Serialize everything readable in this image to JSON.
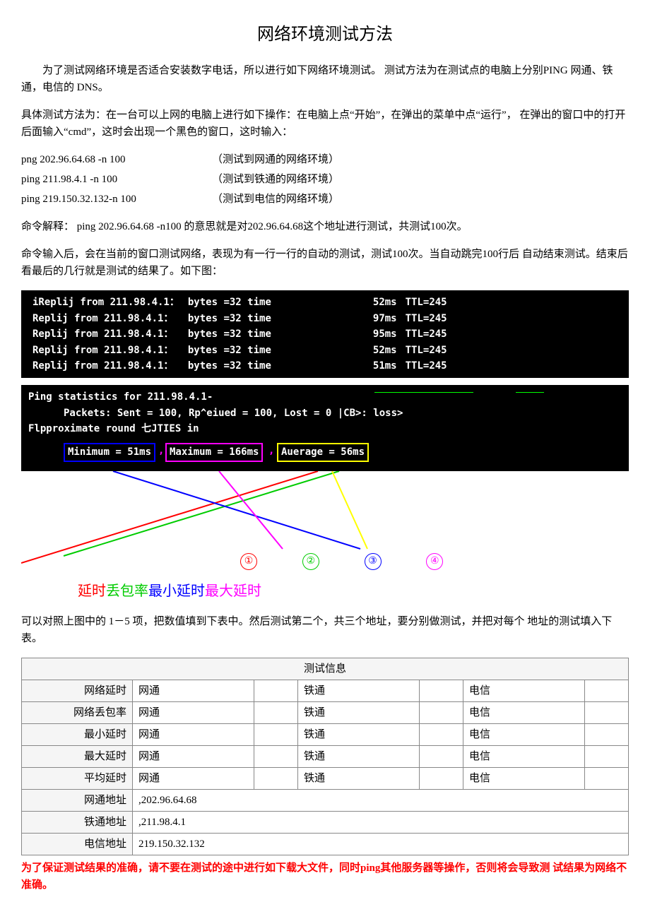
{
  "title": "网络环境测试方法",
  "p1": "为了测试网络环境是否适合安装数字电话，所以进行如下网络环境测试。 测试方法为在测试点的电脑上分别PING 网通、铁通，电信的 DNS。",
  "p2": "具体测试方法为：在一台可以上网的电脑上进行如下操作：在电脑上点“开始”，在弹出的菜单中点“运行”， 在弹出的窗口中的打开后面输入“cmd”，这时会出现一个黑色的窗口，这时输入：",
  "cmds": [
    {
      "cmd": "png 202.96.64.68 -n 100",
      "note": "（测试到网通的网络环境）"
    },
    {
      "cmd": "ping 211.98.4.1 -n 100",
      "note": "（测试到铁通的网络环境）"
    },
    {
      "cmd": "ping 219.150.32.132-n 100",
      "note": "（测试到电信的网络环境）"
    }
  ],
  "explain": "命令解释：  ping 202.96.64.68 -n100 的意思就是对202.96.64.68这个地址进行测试，共测试100次。",
  "p3": "命令输入后，会在当前的窗口测试网络，表现为有一行一行的自动的测试，测试100次。当自动跳完100行后 自动结束测试。结束后看最后的几行就是测试的结果了。如下图：",
  "replies": [
    {
      "a": "iReplij from 211.98.4.1：",
      "b": "bytes =32 time",
      "c": "52ms",
      "d": "TTL=245"
    },
    {
      "a": "Replij from 211.98.4.1：",
      "b": "bytes =32 time",
      "c": "97ms",
      "d": "TTL=245"
    },
    {
      "a": "Replij from 211.98.4.1：",
      "b": "bytes =32 time",
      "c": "95ms",
      "d": "TTL=245"
    },
    {
      "a": "Replij from 211.98.4.1：",
      "b": "bytes =32 time",
      "c": "52ms",
      "d": "TTL=245"
    },
    {
      "a": "Replij from 211.98.4.1：",
      "b": "bytes =32 time",
      "c": "51ms",
      "d": "TTL=245"
    }
  ],
  "stats": {
    "header": "Ping statistics for 211.98.4.1-",
    "packets": "Packets: Sent = 100, Rp^eiued = 100, Lost = 0 |CB>: loss>",
    "approx": "Flpproximate round               七JTIES in",
    "min": "Minimum = 51ms",
    "max": "Maximum = 166ms",
    "avg": "Auerage = 56ms"
  },
  "circles": {
    "c1": "①",
    "c2": "②",
    "c3": "③",
    "c4": "④"
  },
  "legend": {
    "a": "延时",
    "b": "丢包率",
    "c": "最小延时",
    "d": "最大延时"
  },
  "p4": "可以对照上图中的 1－5 项，把数值填到下表中。然后测试第二个，共三个地址，要分别做测试，并把对每个 地址的测试填入下表。",
  "table": {
    "caption": "测试信息",
    "rows": [
      {
        "h": "网络延时",
        "v": [
          "网通",
          "铁通",
          "电信"
        ]
      },
      {
        "h": "网络丢包率",
        "v": [
          "网通",
          "铁通",
          "电信"
        ]
      },
      {
        "h": "最小延时",
        "v": [
          "网通",
          "铁通",
          "电信"
        ]
      },
      {
        "h": "最大延时",
        "v": [
          "网通",
          "铁通",
          "电信"
        ]
      },
      {
        "h": "平均延时",
        "v": [
          "网通",
          "铁通",
          "电信"
        ]
      }
    ],
    "addr": [
      {
        "h": "网通地址",
        "v": ",202.96.64.68"
      },
      {
        "h": "铁通地址",
        "v": ",211.98.4.1"
      },
      {
        "h": "电信地址",
        "v": " 219.150.32.132"
      }
    ]
  },
  "warn": "为了保证测试结果的准确，请不要在测试的途中进行如下载大文件，同时ping其他服务器等操作，否则将会导致测 试结果为网络不准确。"
}
